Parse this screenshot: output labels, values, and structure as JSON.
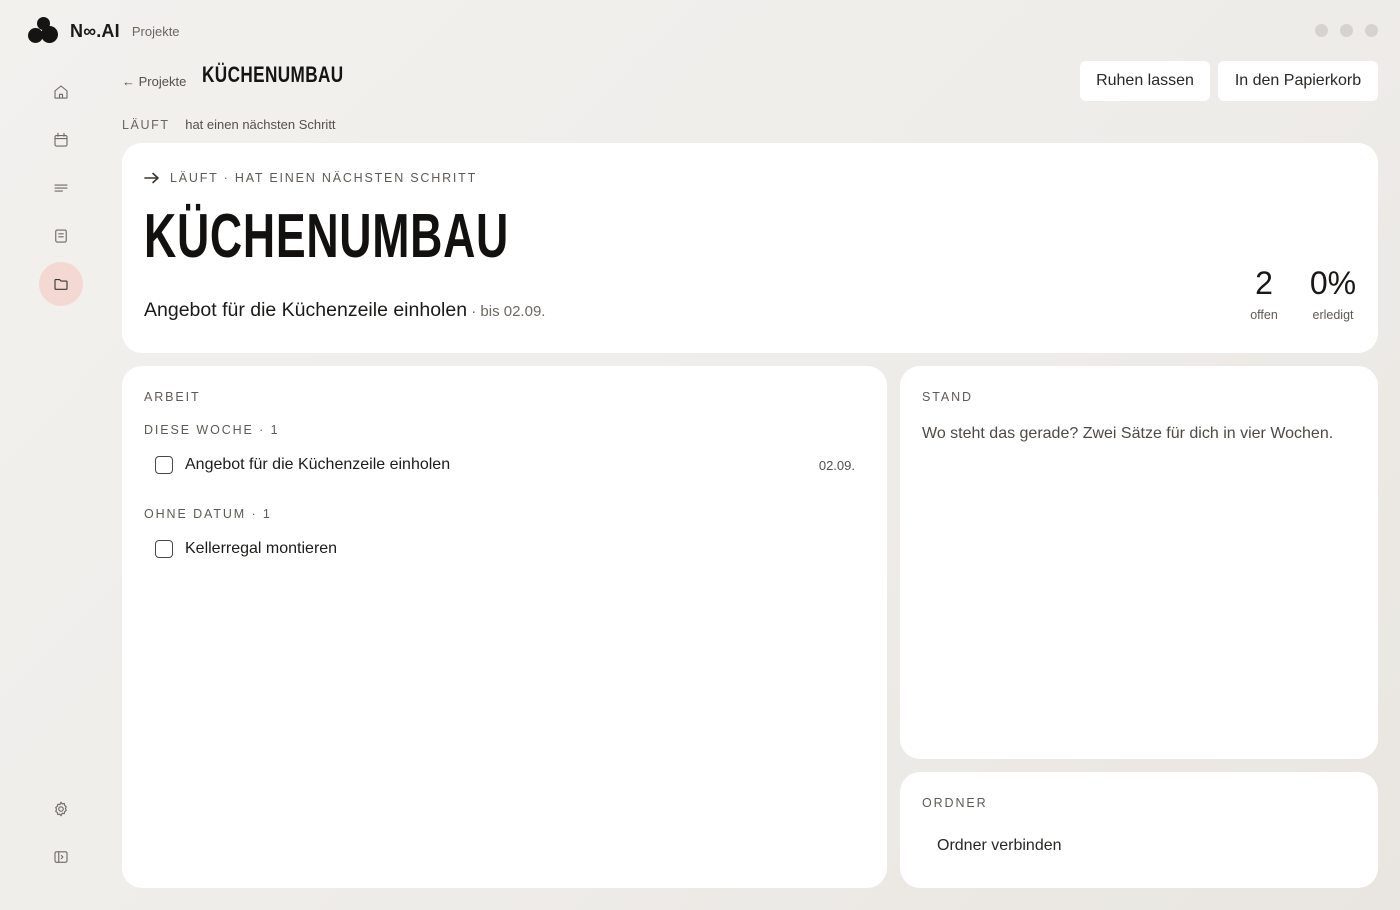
{
  "app": {
    "brand_name": "N∞.AI",
    "section": "Projekte"
  },
  "sidebar": {
    "items": [
      {
        "icon": "home-icon",
        "active": false
      },
      {
        "icon": "calendar-icon",
        "active": false
      },
      {
        "icon": "list-icon",
        "active": false
      },
      {
        "icon": "notes-icon",
        "active": false
      },
      {
        "icon": "folder-icon",
        "active": true
      }
    ],
    "bottom_items": [
      {
        "icon": "gear-icon"
      },
      {
        "icon": "sidebar-toggle-icon"
      }
    ]
  },
  "header": {
    "back_label": "← Projekte",
    "title": "KÜCHENUMBAU",
    "status_caps": "LÄUFT",
    "status_text": "hat einen nächsten Schritt",
    "actions": {
      "rest_label": "Ruhen lassen",
      "trash_label": "In den Papierkorb"
    }
  },
  "hero": {
    "kicker": "LÄUFT · HAT EINEN NÄCHSTEN SCHRITT",
    "title": "KÜCHENUMBAU",
    "next_step": "Angebot für die Küchenzeile einholen",
    "next_due": " · bis 02.09.",
    "stats": [
      {
        "value": "2",
        "label": "offen"
      },
      {
        "value": "0%",
        "label": "erledigt"
      }
    ]
  },
  "work": {
    "label": "ARBEIT",
    "groups": [
      {
        "label": "DIESE WOCHE · 1",
        "tasks": [
          {
            "text": "Angebot für die Küchenzeile einholen",
            "date": "02.09."
          }
        ]
      },
      {
        "label": "OHNE DATUM · 1",
        "tasks": [
          {
            "text": "Kellerregal montieren",
            "date": ""
          }
        ]
      }
    ]
  },
  "stand": {
    "label": "STAND",
    "placeholder": "Wo steht das gerade? Zwei Sätze für dich in vier Wochen."
  },
  "ordner": {
    "label": "ORDNER",
    "connect_label": "Ordner verbinden"
  },
  "colors": {
    "accent_active": "#f3d9d1",
    "background": "#efedea",
    "card": "#ffffff"
  }
}
